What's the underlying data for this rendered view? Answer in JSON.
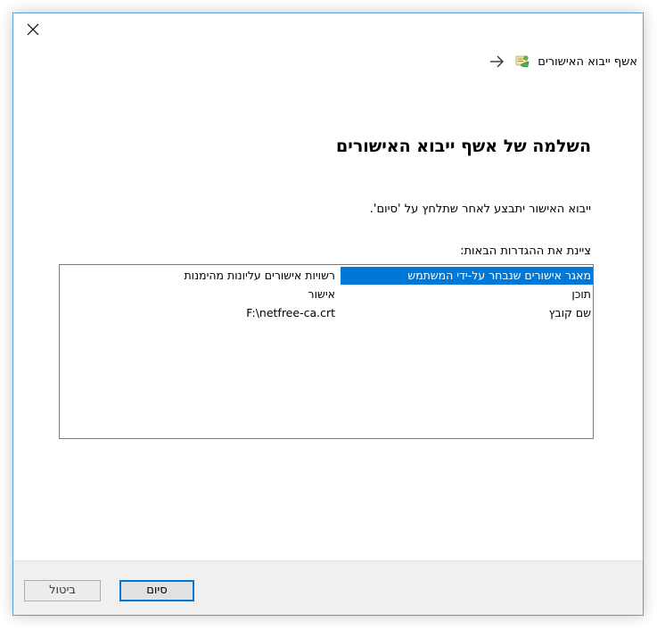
{
  "window": {
    "close_icon": "close-icon",
    "header": {
      "back_icon": "back-arrow-icon",
      "wizard_icon": "certificate-wizard-icon",
      "title": "אשף ייבוא האישורים"
    },
    "heading": "השלמה של אשף ייבוא האישורים",
    "description": "ייבוא האישור יתבצע לאחר שתלחץ על 'סיום'.",
    "settings_label": "ציינת את ההגדרות הבאות:",
    "settings": [
      {
        "key": "מאגר אישורים שנבחר על-ידי המשתמש",
        "value": "רשויות אישורים עליונות מהימנות",
        "selected": true
      },
      {
        "key": "תוכן",
        "value": "אישור",
        "selected": false
      },
      {
        "key": "שם קובץ",
        "value": "F:\\netfree-ca.crt",
        "selected": false
      }
    ],
    "buttons": {
      "finish": "סיום",
      "cancel": "ביטול"
    },
    "colors": {
      "selection": "#0078d7",
      "window_border": "#5b9bd5",
      "footer_bg": "#f0f0f0"
    }
  }
}
